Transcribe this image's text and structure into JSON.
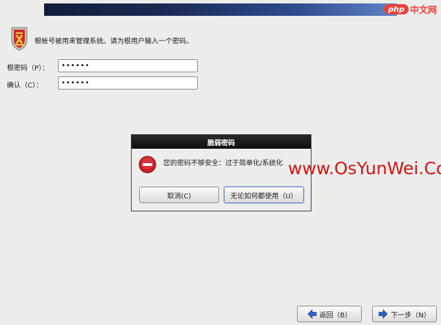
{
  "installer": {
    "intro_text": "根帐号被用来管理系统。请为根用户输入一个密码。",
    "root_password_label": "根密码（P）：",
    "confirm_label": "确认（C）：",
    "root_password_value": "••••••",
    "confirm_value": "••••••"
  },
  "dialog": {
    "title": "脆弱密码",
    "message": "您的密码不够安全：过于简单化/系统化",
    "cancel_label": "取消(C)",
    "use_anyway_label": "无论如何都使用（U）"
  },
  "navigation": {
    "back_label": "返回（B）",
    "next_label": "下一步（N）"
  },
  "watermarks": {
    "top_php": "php",
    "top_cn": "中文网",
    "site": "www.OsYunWei.Com"
  },
  "icons": {
    "shield": "root-shield-icon",
    "warning": "stop-warning-icon",
    "back": "left-arrow-icon",
    "next": "right-arrow-icon"
  },
  "colors": {
    "header_gradient_start": "#121d3a",
    "header_gradient_end": "#5f84c6",
    "warning_red": "#c8202a",
    "watermark_red": "#d11313",
    "arrow_blue": "#2f62c8"
  }
}
